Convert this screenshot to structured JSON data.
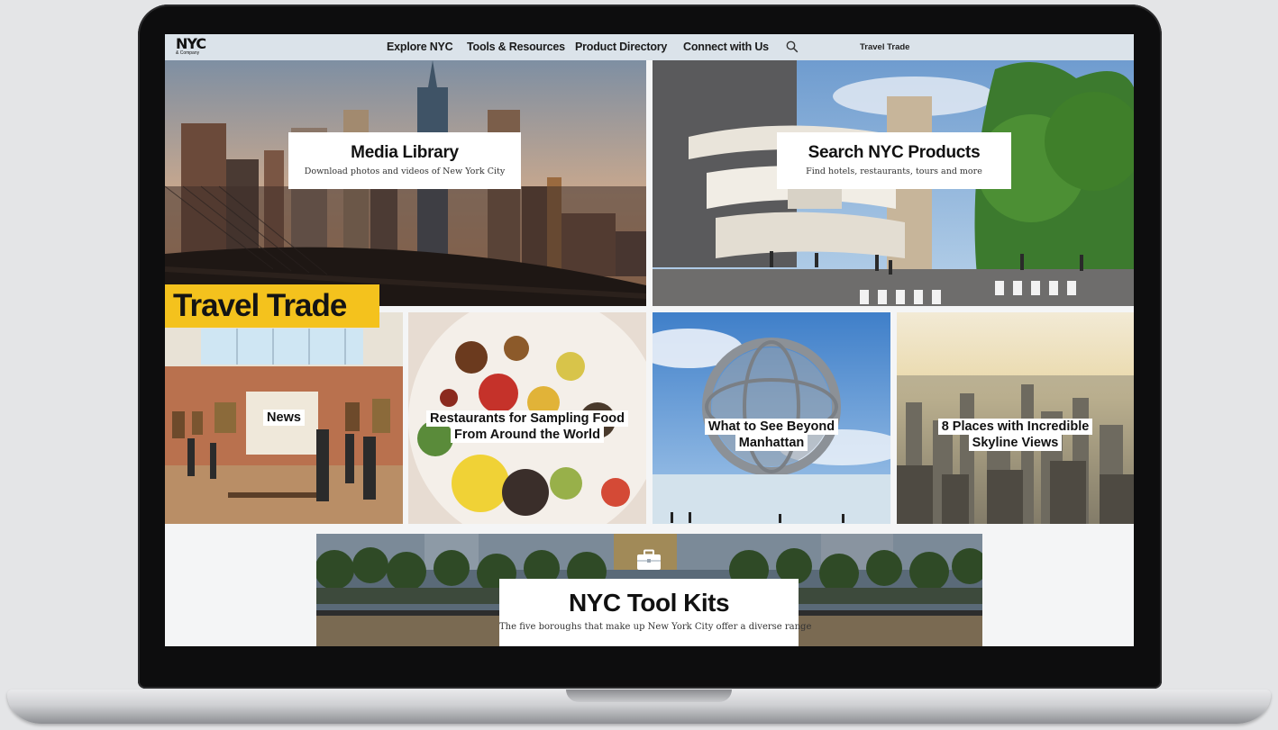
{
  "nav": {
    "logo_main": "NYC",
    "logo_sub": "& Company",
    "links": [
      "Explore NYC",
      "Tools & Resources",
      "Product Directory",
      "Connect with Us"
    ],
    "secondary": "Travel Trade",
    "search_icon": "search-icon"
  },
  "hero": {
    "media_library": {
      "title": "Media Library",
      "subtitle": "Download photos and videos of New York City"
    },
    "search_products": {
      "title": "Search NYC Products",
      "subtitle": "Find hotels, restaurants, tours and more"
    }
  },
  "section_badge": "Travel Trade",
  "cards": [
    {
      "label": "News"
    },
    {
      "label": "Restaurants for Sampling Food From Around the World"
    },
    {
      "label": "What to See Beyond Manhattan"
    },
    {
      "label": "8 Places with Incredible Skyline Views"
    }
  ],
  "toolkits": {
    "title": "NYC Tool Kits",
    "description": "The five boroughs that make up New York City offer a diverse range",
    "icon": "briefcase-icon"
  },
  "colors": {
    "badge": "#f4c21d",
    "nav_bg": "#dbe3ea"
  }
}
